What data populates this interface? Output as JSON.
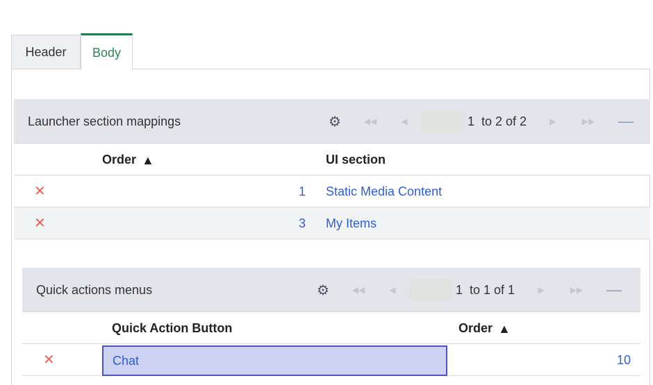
{
  "tabs": [
    {
      "label": "Header",
      "active": false
    },
    {
      "label": "Body",
      "active": true
    }
  ],
  "launcher": {
    "title": "Launcher section mappings",
    "pager": {
      "current_page": "1",
      "range": "to 2 of 2"
    },
    "columns": {
      "order": "Order",
      "ui_section": "UI section"
    },
    "rows": [
      {
        "order": "1",
        "ui_section": "Static Media Content"
      },
      {
        "order": "3",
        "ui_section": "My Items"
      }
    ]
  },
  "quick_actions": {
    "title": "Quick actions menus",
    "pager": {
      "current_page": "1",
      "range": "to 1 of 1"
    },
    "columns": {
      "button": "Quick Action Button",
      "order": "Order"
    },
    "rows": [
      {
        "button": "Chat",
        "order": "10"
      }
    ]
  },
  "icons": {
    "settings": "gear-icon",
    "first": "first-page-icon",
    "prev": "prev-page-icon",
    "next": "next-page-icon",
    "last": "last-page-icon",
    "collapse": "collapse-icon",
    "delete": "delete-icon",
    "sort": "sort-ascending-icon"
  },
  "colors": {
    "accent_green": "#1f7a4d",
    "link_blue": "#2f5fd6",
    "delete_red": "#e0665a",
    "header_gray": "#e3e5ea",
    "selected_cell": "#ced2f1"
  }
}
